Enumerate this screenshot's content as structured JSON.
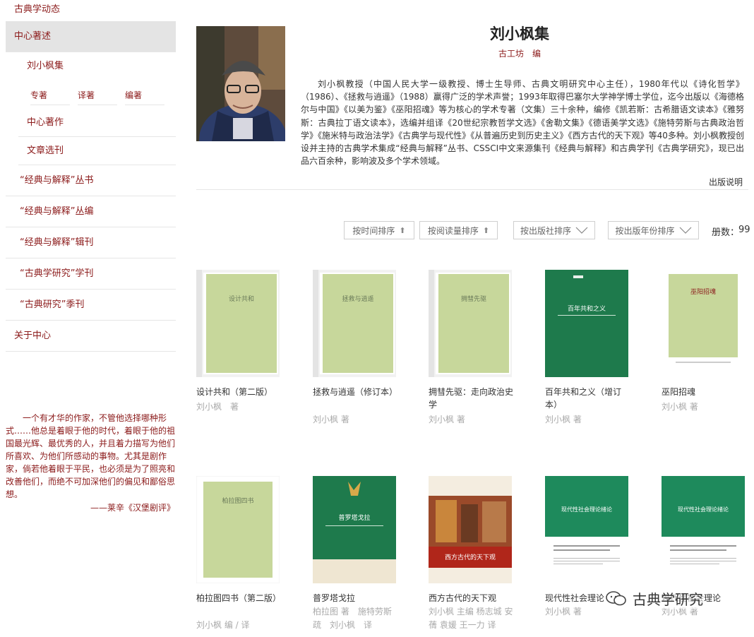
{
  "sidebar": {
    "top_item": "古典学动态",
    "active_item": "中心著述",
    "sub_item": "刘小枫集",
    "tabs": [
      "专著",
      "译著",
      "编著"
    ],
    "items_lvl2": [
      "中心著作",
      "文章选刊"
    ],
    "items_lvl1": [
      "“经典与解释”丛书",
      "“经典与解释”丛编",
      "“经典与解释”辑刊",
      "“古典学研究”学刊",
      "“古典研究”季刊"
    ],
    "about": "关于中心"
  },
  "quote": {
    "text": "一个有才华的作家，不管他选择哪种形式……他总是着眼于他的时代，着眼于他的祖国最光辉、最优秀的人，并且着力描写为他们所喜欢、为他们所感动的事物。尤其是剧作家，倘若他着眼于平民，也必须是为了照亮和改善他们，而绝不可加深他们的偏见和鄙俗思想。",
    "source": "——莱辛《汉堡剧评》"
  },
  "collection": {
    "title": "刘小枫集",
    "editor": "古工坊　编",
    "description": "刘小枫教授（中国人民大学一级教授、博士生导师、古典文明研究中心主任），1980年代以《诗化哲学》（1986）、《拯救与逍遥》（1988）赢得广泛的学术声誉；1993年取得巴塞尔大学神学博士学位，迄今出版以《海德格尔与中国》《以美为鉴》《巫阳招魂》等为核心的学术专著（文集）三十余种，编修《凯若斯：古希腊语文读本》《雅努斯：古典拉丁语文读本》，选编并组译《20世纪宗教哲学文选》《舍勒文集》《德语美学文选》《施特劳斯与古典政治哲学》《施米特与政治法学》《古典学与现代性》《从普遍历史到历史主义》《西方古代的天下观》等40多种。刘小枫教授创设并主持的古典学术集成“经典与解释”丛书、CSSCI中文来源集刊《经典与解释》和古典学刊《古典学研究》，现已出品六百余种，影响波及多个学术领域。",
    "pub_note": "出版说明"
  },
  "sort": {
    "buttons": [
      "按时间排序",
      "按阅读量排序",
      "按出版社排序",
      "按出版年份排序"
    ],
    "count_label": "册数：",
    "count": "99"
  },
  "books": [
    {
      "title": "设计共和（第二版）",
      "author": "刘小枫　著",
      "cover_title": "设计共和"
    },
    {
      "title": "拯救与逍遥（修订本）",
      "author": "刘小枫 著",
      "cover_title": "拯救与逍遥"
    },
    {
      "title": "拥彗先驱：走向政治史学",
      "author": "刘小枫 著",
      "cover_title": "拥彗先驱"
    },
    {
      "title": "百年共和之义（增订本）",
      "author": "刘小枫 著",
      "cover_title": "百年共和之义"
    },
    {
      "title": "巫阳招魂",
      "author": "刘小枫 著",
      "cover_title": "巫阳招魂"
    },
    {
      "title": "柏拉图四书（第二版）",
      "author": "刘小枫 编 / 译",
      "cover_title": "柏拉图四书"
    },
    {
      "title": "普罗塔戈拉",
      "author": "柏拉图 著　施特劳斯　疏　刘小枫　译",
      "cover_title": "普罗塔戈拉"
    },
    {
      "title": "西方古代的天下观",
      "author": "刘小枫 主编 杨志城 安蒨 袁媛 王一力 译",
      "cover_title": "西方古代的天下观"
    },
    {
      "title": "现代性社会理论",
      "author": "刘小枫 著",
      "cover_title": "现代性社会理论绪论"
    },
    {
      "title": "现代性社会理论",
      "author": "刘小枫 著",
      "cover_title": "现代性社会理论绪论"
    }
  ],
  "watermark": "古典学研究",
  "colors": {
    "accent": "#8b1a1a",
    "active_bg": "#e4e4e4",
    "cover_green_light": "#c7d79b",
    "cover_green_dark": "#1e7a4c"
  }
}
